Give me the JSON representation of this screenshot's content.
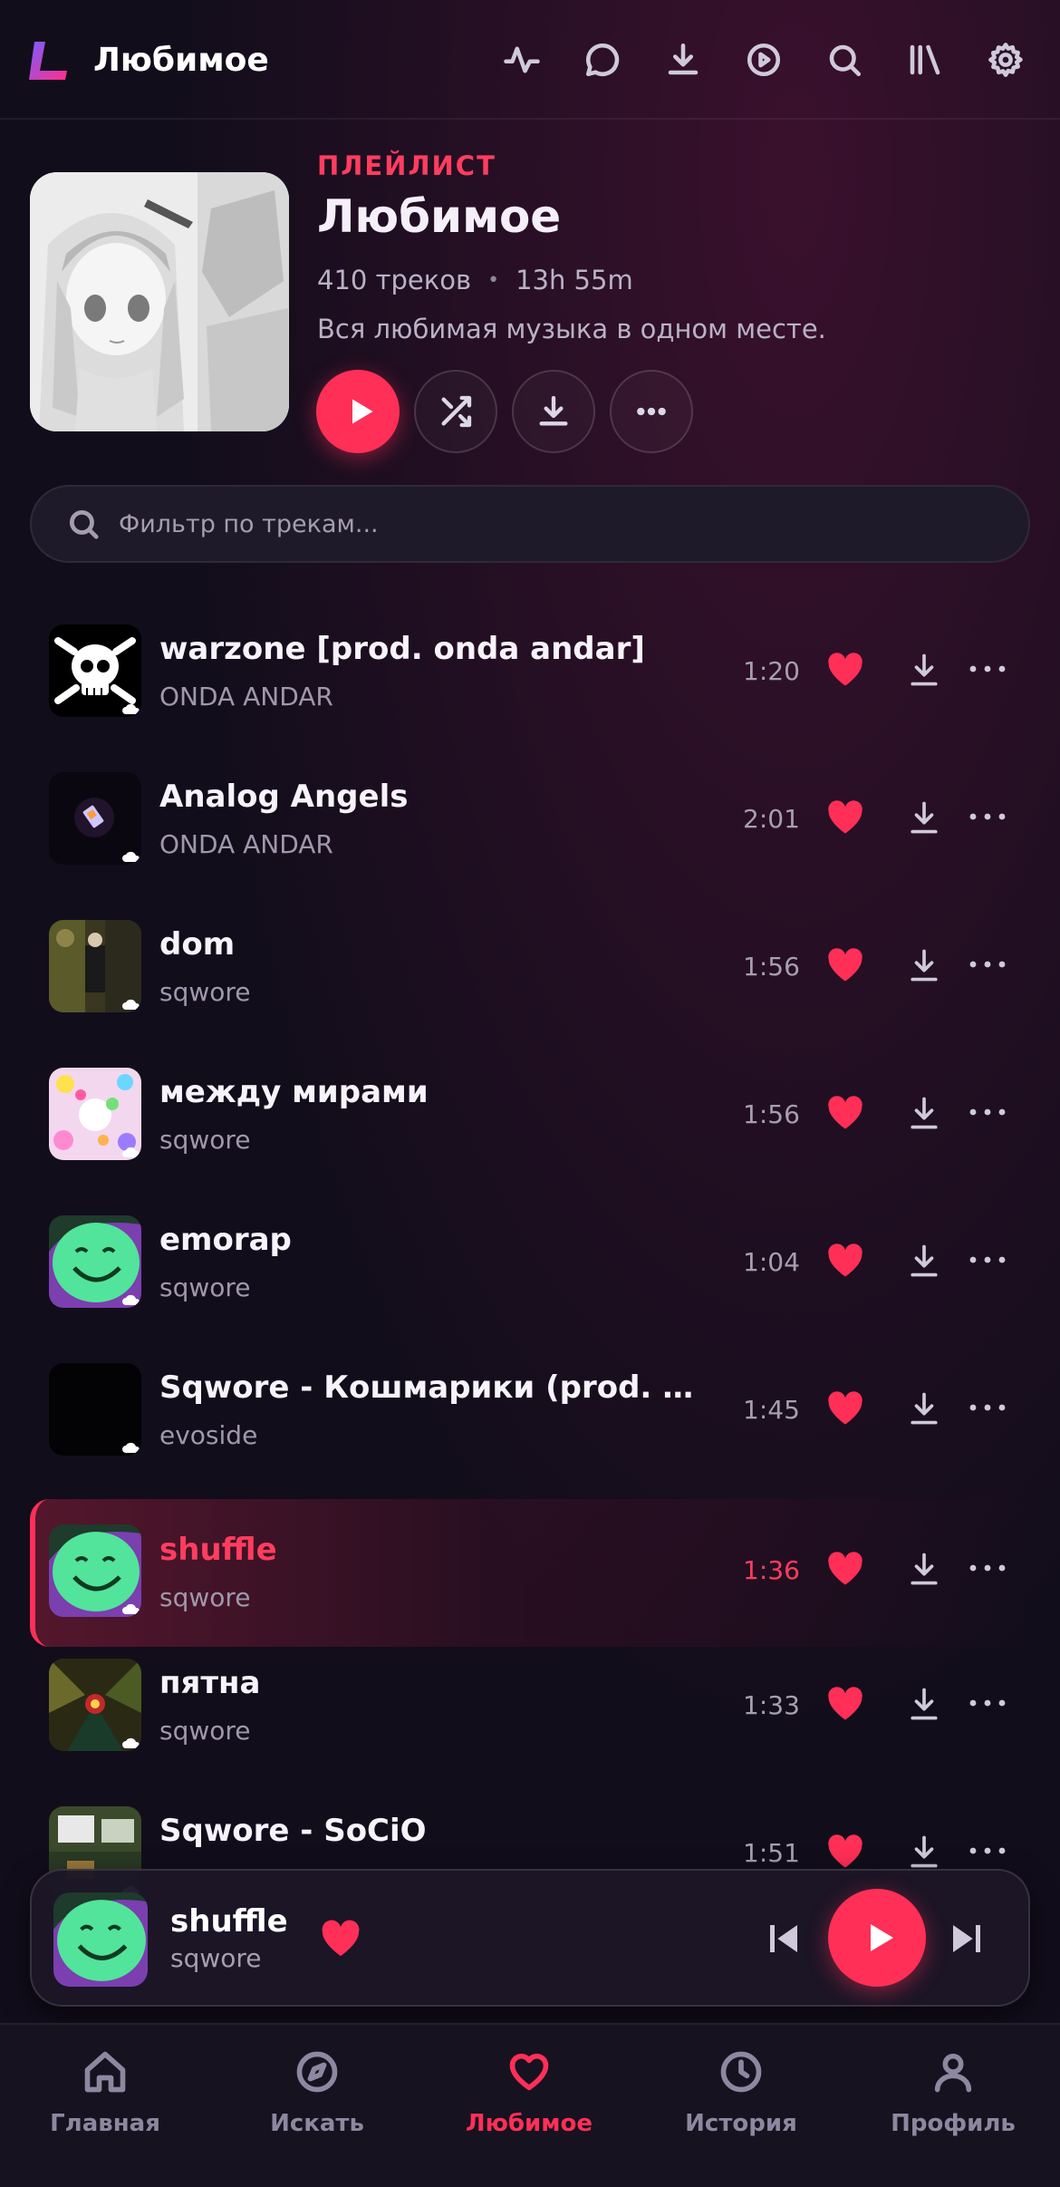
{
  "topbar": {
    "title": "Любимое",
    "icons": [
      "activity-icon",
      "chat-icon",
      "download-icon",
      "play-circle-icon",
      "search-icon",
      "library-icon",
      "gear-icon"
    ]
  },
  "playlist": {
    "label": "ПЛЕЙЛИСТ",
    "title": "Любимое",
    "track_count": "410 треков",
    "separator": "•",
    "duration": "13h 55m",
    "description": "Вся любимая музыка в одном месте."
  },
  "filter": {
    "placeholder": "Фильтр по трекам...",
    "value": ""
  },
  "tracks": [
    {
      "title": "warzone [prod. onda andar]",
      "artist": "ONDA ANDAR",
      "duration": "1:20",
      "liked": true,
      "active": false
    },
    {
      "title": "Analog Angels",
      "artist": "ONDA ANDAR",
      "duration": "2:01",
      "liked": true,
      "active": false
    },
    {
      "title": "dom",
      "artist": "sqwore",
      "duration": "1:56",
      "liked": true,
      "active": false
    },
    {
      "title": "между мирами",
      "artist": "sqwore",
      "duration": "1:56",
      "liked": true,
      "active": false
    },
    {
      "title": "emorap",
      "artist": "sqwore",
      "duration": "1:04",
      "liked": true,
      "active": false
    },
    {
      "title": "Sqwore - Кошмарики (prod. evo...",
      "artist": "evoside",
      "duration": "1:45",
      "liked": true,
      "active": false
    },
    {
      "title": "shuffle",
      "artist": "sqwore",
      "duration": "1:36",
      "liked": true,
      "active": true
    },
    {
      "title": "пятна",
      "artist": "sqwore",
      "duration": "1:33",
      "liked": true,
      "active": false
    },
    {
      "title": "Sqwore - SoCiO",
      "artist": "",
      "duration": "1:51",
      "liked": true,
      "active": false
    }
  ],
  "now_playing": {
    "title": "shuffle",
    "artist": "sqwore",
    "liked": true
  },
  "bottom_nav": [
    {
      "label": "Главная",
      "icon": "home-icon",
      "active": false
    },
    {
      "label": "Искать",
      "icon": "compass-icon",
      "active": false
    },
    {
      "label": "Любимое",
      "icon": "heart-icon",
      "active": true
    },
    {
      "label": "История",
      "icon": "clock-icon",
      "active": false
    },
    {
      "label": "Профиль",
      "icon": "user-icon",
      "active": false
    }
  ],
  "colors": {
    "accent": "#ff2f57",
    "background": "#120d1b",
    "text_secondary": "#a59fb1"
  }
}
